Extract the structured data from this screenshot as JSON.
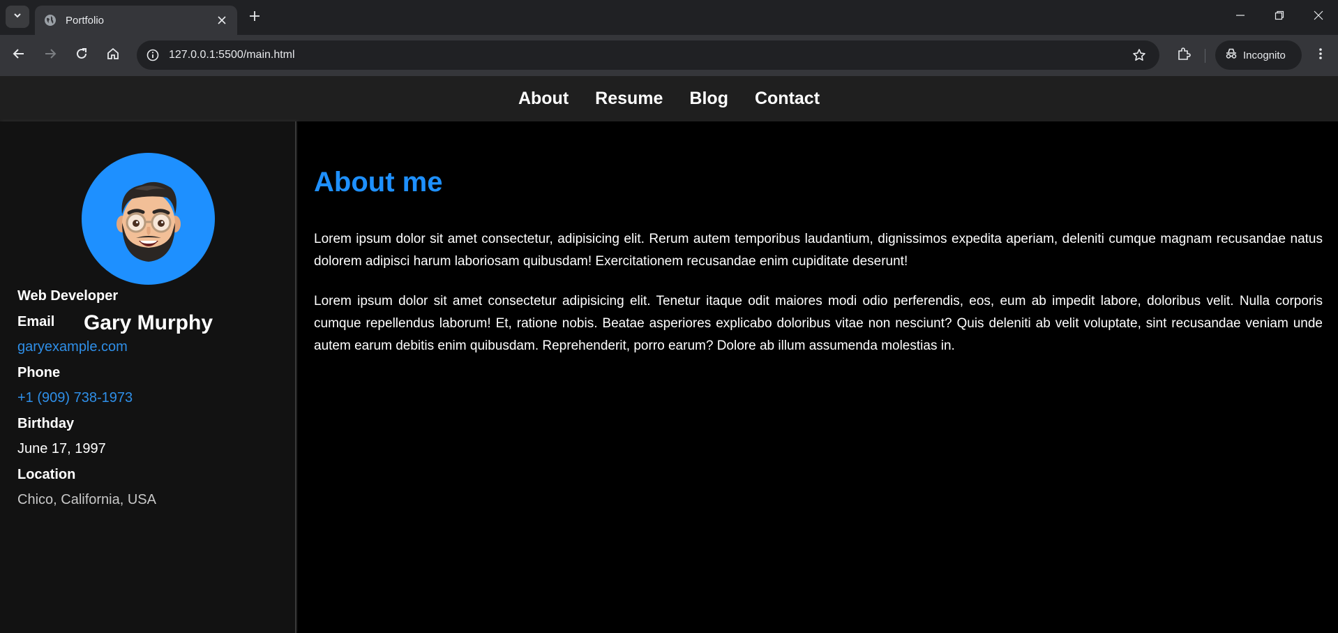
{
  "browser": {
    "tab_title": "Portfolio",
    "url": "127.0.0.1:5500/main.html",
    "incognito_label": "Incognito"
  },
  "nav": {
    "items": [
      "About",
      "Resume",
      "Blog",
      "Contact"
    ]
  },
  "profile": {
    "name": "Gary Murphy",
    "role": "Web Developer",
    "email_label": "Email",
    "email": "garyexample.com",
    "phone_label": "Phone",
    "phone": "+1 (909) 738-1973",
    "birthday_label": "Birthday",
    "birthday": "June 17, 1997",
    "location_label": "Location",
    "location": "Chico, California, USA"
  },
  "about": {
    "heading": "About me",
    "paragraphs": [
      "Lorem ipsum dolor sit amet consectetur, adipisicing elit. Rerum autem temporibus laudantium, dignissimos expedita aperiam, deleniti cumque magnam recusandae natus dolorem adipisci harum laboriosam quibusdam! Exercitationem recusandae enim cupiditate deserunt!",
      "Lorem ipsum dolor sit amet consectetur adipisicing elit. Tenetur itaque odit maiores modi odio perferendis, eos, eum ab impedit labore, doloribus velit. Nulla corporis cumque repellendus laborum! Et, ratione nobis. Beatae asperiores explicabo doloribus vitae non nesciunt? Quis deleniti ab velit voluptate, sint recusandae veniam unde autem earum debitis enim quibusdam. Reprehenderit, porro earum? Dolore ab illum assumenda molestias in."
    ]
  },
  "colors": {
    "accent": "#1e90ff",
    "link": "#2f8fe8",
    "nav_bg": "#1f1f1f",
    "sidebar_bg": "#121212",
    "main_bg": "#000000"
  }
}
